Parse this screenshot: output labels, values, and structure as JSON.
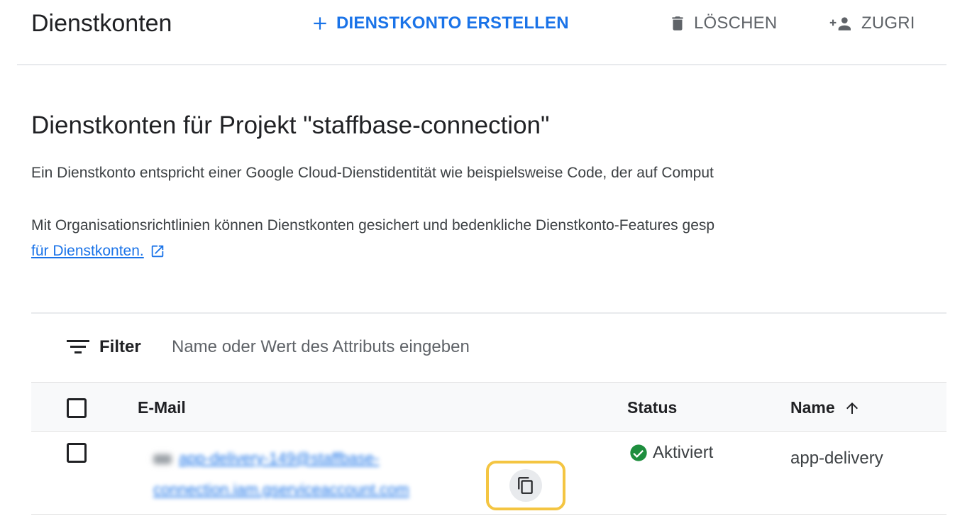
{
  "toolbar": {
    "title": "Dienstkonten",
    "create_label": "DIENSTKONTO ERSTELLEN",
    "delete_label": "LÖSCHEN",
    "access_label": "ZUGRI"
  },
  "section": {
    "title": "Dienstkonten für Projekt \"staffbase-connection\"",
    "description_1": "Ein Dienstkonto entspricht einer Google Cloud-Dienstidentität wie beispielsweise Code, der auf Comput",
    "description_2": "Mit Organisationsrichtlinien können Dienstkonten gesichert und bedenkliche Dienstkonto-Features gesp",
    "link_text": "für Dienstkonten."
  },
  "filter": {
    "label": "Filter",
    "placeholder": "Name oder Wert des Attributs eingeben"
  },
  "table": {
    "columns": {
      "email": "E-Mail",
      "status": "Status",
      "name": "Name"
    },
    "rows": [
      {
        "email_line_1": "app-delivery-149@staffbase-",
        "email_line_2": "connection.iam.gserviceaccount.com",
        "status": "Aktiviert",
        "name": "app-delivery"
      }
    ]
  },
  "colors": {
    "accent": "#1a73e8",
    "status_ok": "#1e8e3e",
    "highlight": "#f4c542"
  }
}
